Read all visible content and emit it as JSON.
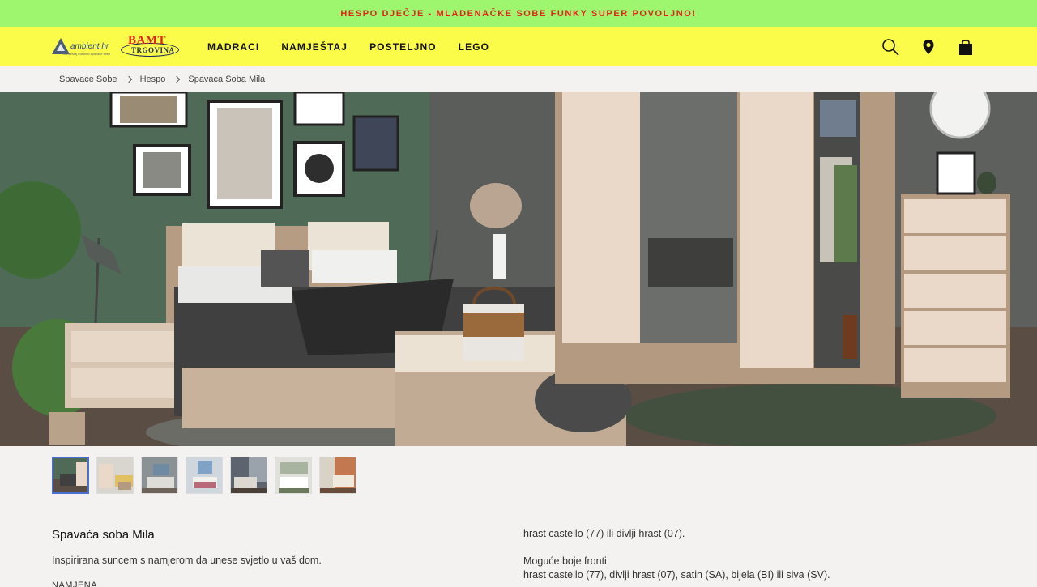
{
  "promo": {
    "text": "HESPO DJEČJE - MLADENAČKE SOBE FUNKY SUPER POVOLJNO!"
  },
  "header": {
    "logo_ambient": {
      "text": "ambient.hr",
      "tagline": "namještaj madraci spavaće sobe"
    },
    "logo_bamt": {
      "line1": "BAMT",
      "line2": "TRGOVINA"
    },
    "nav": [
      "MADRACI",
      "NAMJEŠTAJ",
      "POSTELJNO",
      "LEGO"
    ],
    "icons": [
      "search-icon",
      "location-pin-icon",
      "shopping-bag-icon"
    ]
  },
  "breadcrumb": [
    "Spavace Sobe",
    "Hespo",
    "Spavaca Soba Mila"
  ],
  "gallery": {
    "thumbnail_count": 7,
    "active_index": 0
  },
  "product": {
    "title": "Spavaća soba Mila",
    "description": "Inspirirana suncem s namjerom da unese svjetlo u vaš dom.",
    "section_label": "NAMJENA",
    "right_column": {
      "line1": "hrast castello (77) ili divlji hrast (07).",
      "line2": "Moguće boje fronti:",
      "line3": "hrast castello (77), divlji hrast (07), satin (SA), bijela (BI) ili siva (SV)."
    }
  },
  "colors": {
    "promo_bg": "#9ef56e",
    "promo_text": "#e2231a",
    "header_bg": "#fbfb4a",
    "page_bg": "#f4f2f0"
  }
}
